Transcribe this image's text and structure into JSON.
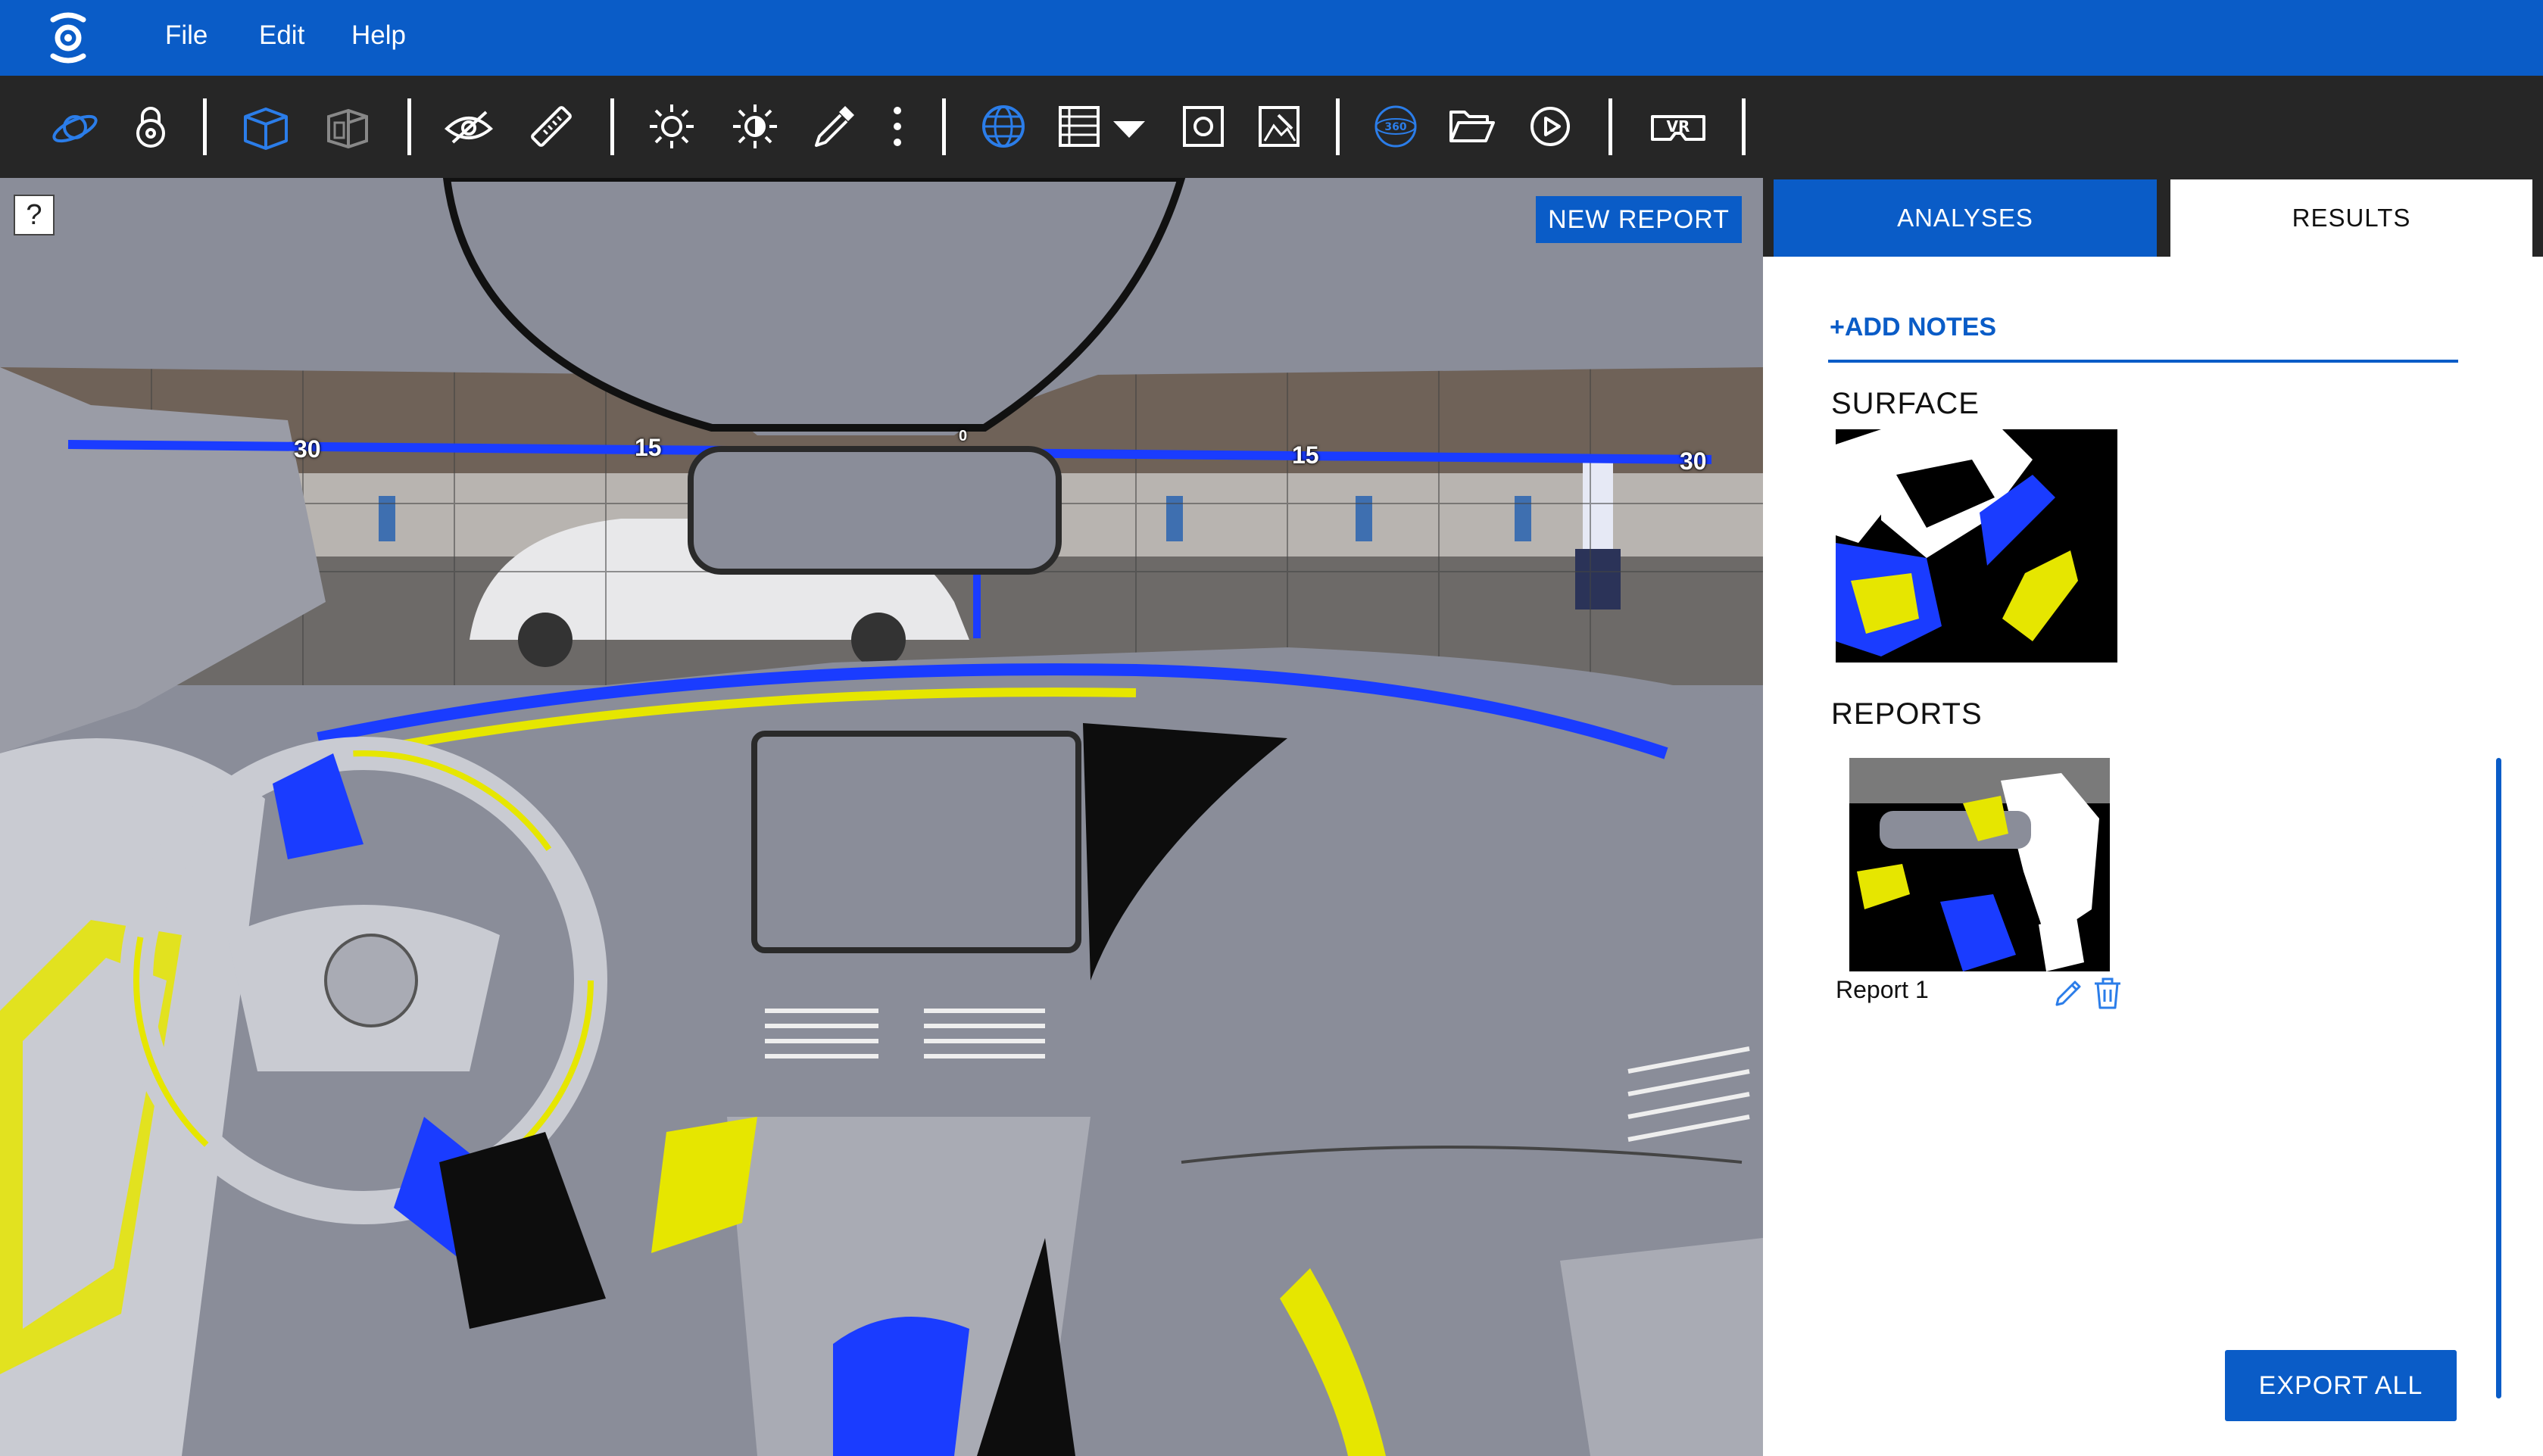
{
  "menubar": {
    "logo_icon": "app-logo-icon",
    "items": [
      {
        "label": "File"
      },
      {
        "label": "Edit"
      },
      {
        "label": "Help"
      }
    ]
  },
  "toolbar": {
    "tools": [
      "orbit-icon",
      "lock-icon",
      "3d-box-icon",
      "section-view-icon",
      "eye-slash-icon",
      "ruler-icon",
      "sun-icon",
      "sun-adjust-icon",
      "eyedropper-icon",
      "more-vertical-icon",
      "globe-icon",
      "film-grid-icon",
      "dropdown-caret-icon",
      "snapshot-icon",
      "image-edit-icon",
      "view-360-icon",
      "folder-open-icon",
      "play-icon",
      "vr-headset-icon"
    ],
    "vr_label": "VR",
    "view360_label": "360"
  },
  "viewport": {
    "help_label": "?",
    "new_report_label": "NEW REPORT",
    "scale_ticks": [
      "30",
      "15",
      "0",
      "15",
      "30"
    ]
  },
  "panel": {
    "tabs": [
      {
        "label": "ANALYSES"
      },
      {
        "label": "RESULTS",
        "active": true
      }
    ],
    "add_notes_label": "+ADD NOTES",
    "surface_title": "SURFACE",
    "reports_title": "REPORTS",
    "reports": [
      {
        "name": "Report 1"
      }
    ],
    "export_all_label": "EXPORT ALL"
  },
  "colors": {
    "accent_blue": "#0a5cc7",
    "toolbar_bg": "#262626",
    "highlight_yellow": "#e6e600",
    "highlight_blue": "#1a3cff"
  }
}
